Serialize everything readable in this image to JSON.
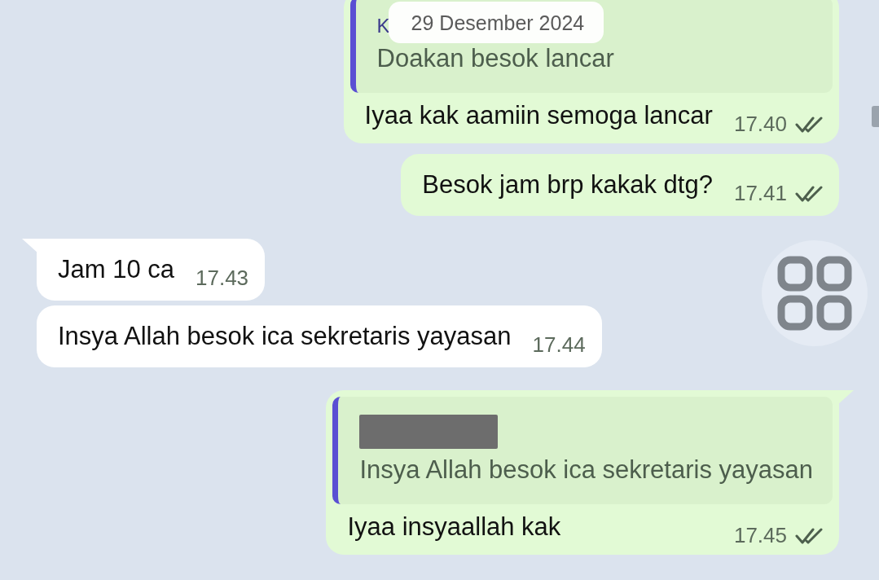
{
  "date_chip": "29 Desember 2024",
  "messages": [
    {
      "outgoing": true,
      "tail": false,
      "quote": {
        "author": "K",
        "redacted": false,
        "text": "Doakan besok lancar"
      },
      "text": "Iyaa kak aamiin semoga lancar",
      "time": "17.40",
      "read": true
    },
    {
      "outgoing": true,
      "tail": false,
      "text": "Besok jam brp kakak dtg?",
      "time": "17.41",
      "read": true
    },
    {
      "outgoing": false,
      "tail": true,
      "text": "Jam 10 ca",
      "time": "17.43"
    },
    {
      "outgoing": false,
      "tail": false,
      "text": "Insya Allah besok ica sekretaris yayasan",
      "time": "17.44"
    },
    {
      "outgoing": true,
      "tail": true,
      "quote": {
        "redacted": true,
        "text": "Insya Allah besok ica sekretaris yayasan"
      },
      "text": "Iyaa insyaallah kak",
      "time": "17.45",
      "read": true
    }
  ]
}
